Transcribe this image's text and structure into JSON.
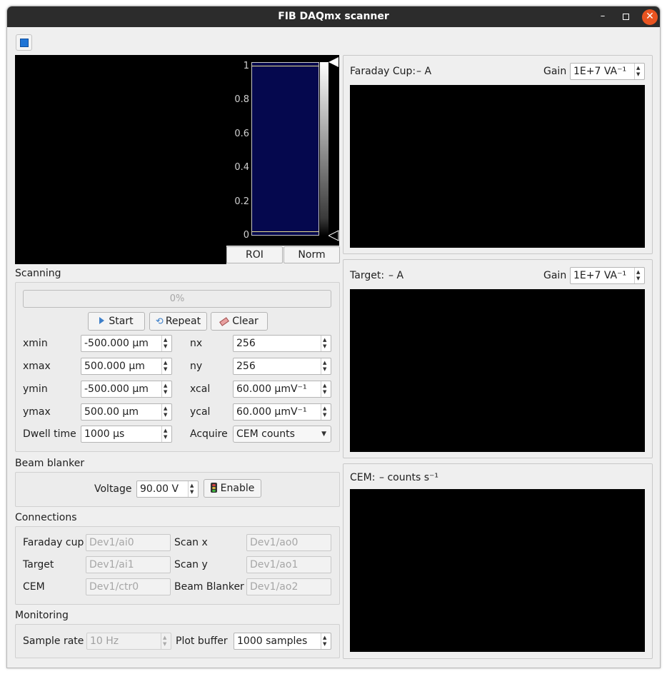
{
  "window": {
    "title": "FIB DAQmx scanner",
    "minimize": "–",
    "maximize": "□",
    "close": "✕"
  },
  "histogram": {
    "ticks": [
      "1",
      "0.8",
      "0.6",
      "0.4",
      "0.2",
      "0"
    ],
    "roi_label": "ROI",
    "norm_label": "Norm"
  },
  "scanning": {
    "title": "Scanning",
    "progress_text": "0%",
    "progress": 0,
    "start_label": "Start",
    "repeat_label": "Repeat",
    "clear_label": "Clear",
    "xmin_label": "xmin",
    "xmin_value": "-500.000 µm",
    "xmax_label": "xmax",
    "xmax_value": "500.000 µm",
    "ymin_label": "ymin",
    "ymin_value": "-500.000 µm",
    "ymax_label": "ymax",
    "ymax_value": "500.00 µm",
    "dwell_label": "Dwell time",
    "dwell_value": "1000 µs",
    "nx_label": "nx",
    "nx_value": "256",
    "ny_label": "ny",
    "ny_value": "256",
    "xcal_label": "xcal",
    "xcal_value": "60.000 µmV⁻¹",
    "ycal_label": "ycal",
    "ycal_value": "60.000 µmV⁻¹",
    "acquire_label": "Acquire",
    "acquire_value": "CEM counts"
  },
  "blanker": {
    "title": "Beam blanker",
    "voltage_label": "Voltage",
    "voltage_value": "90.00 V",
    "enable_label": "Enable"
  },
  "connections": {
    "title": "Connections",
    "faraday_label": "Faraday cup",
    "faraday_value": "Dev1/ai0",
    "target_label": "Target",
    "target_value": "Dev1/ai1",
    "cem_label": "CEM",
    "cem_value": "Dev1/ctr0",
    "scanx_label": "Scan x",
    "scanx_value": "Dev1/ao0",
    "scany_label": "Scan y",
    "scany_value": "Dev1/ao1",
    "blanker_label": "Beam Blanker",
    "blanker_value": "Dev1/ao2"
  },
  "monitoring": {
    "title": "Monitoring",
    "rate_label": "Sample rate",
    "rate_value": "10 Hz",
    "buffer_label": "Plot buffer",
    "buffer_value": "1000 samples"
  },
  "faraday_panel": {
    "label": "Faraday Cup:",
    "value": "– A",
    "gain_label": "Gain",
    "gain_value": "1E+7 VA⁻¹"
  },
  "target_panel": {
    "label": "Target:",
    "value": "– A",
    "gain_label": "Gain",
    "gain_value": "1E+7 VA⁻¹"
  },
  "cem_panel": {
    "label": "CEM:",
    "value": "– counts s⁻¹"
  },
  "colors": {
    "accent": "#e95420",
    "histogram_fill": "#05084e",
    "toolbar_icon": "#1e74d6"
  }
}
